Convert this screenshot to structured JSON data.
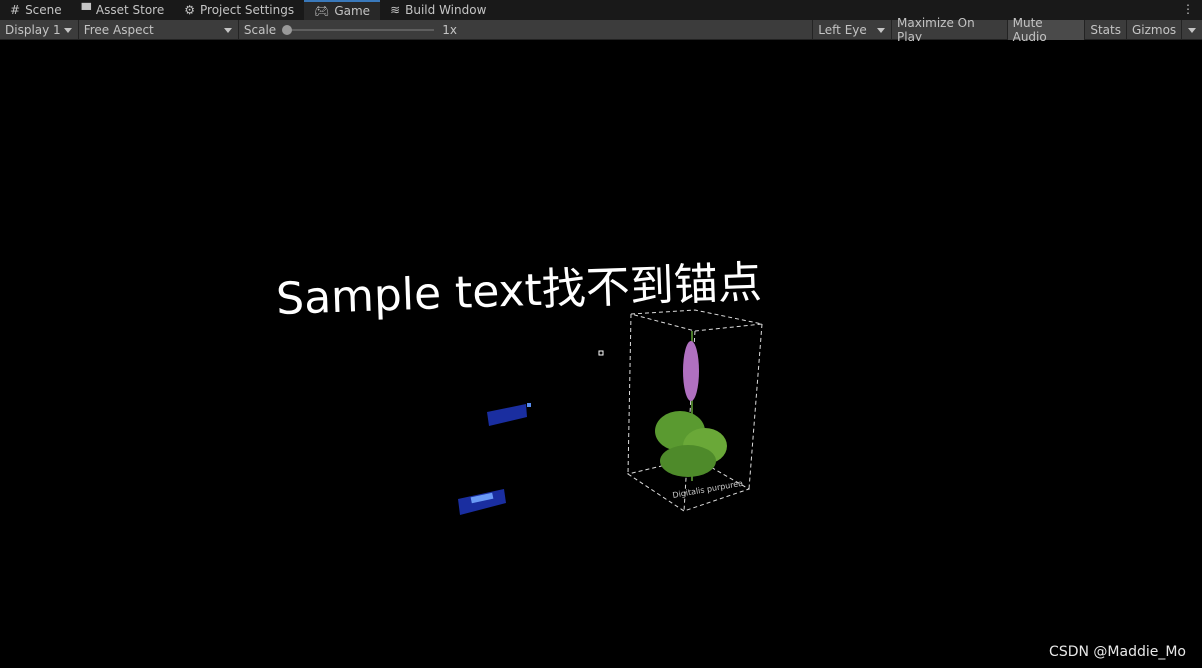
{
  "tabs": [
    {
      "label": "Scene",
      "icon": "grid-icon"
    },
    {
      "label": "Asset Store",
      "icon": "bag-icon"
    },
    {
      "label": "Project Settings",
      "icon": "gear-icon"
    },
    {
      "label": "Game",
      "icon": "gamepad-icon",
      "active": true
    },
    {
      "label": "Build Window",
      "icon": "layers-icon"
    }
  ],
  "toolbar": {
    "display": "Display 1",
    "aspect": "Free Aspect",
    "scale_label": "Scale",
    "scale_value": "1x",
    "eye": "Left Eye",
    "maximize": "Maximize On Play",
    "mute": "Mute Audio",
    "stats": "Stats",
    "gizmos": "Gizmos"
  },
  "scene": {
    "sample_text": "Sample text找不到锚点",
    "plant_label": "Digitalis purpurea"
  },
  "watermark": "CSDN @Maddie_Mo"
}
